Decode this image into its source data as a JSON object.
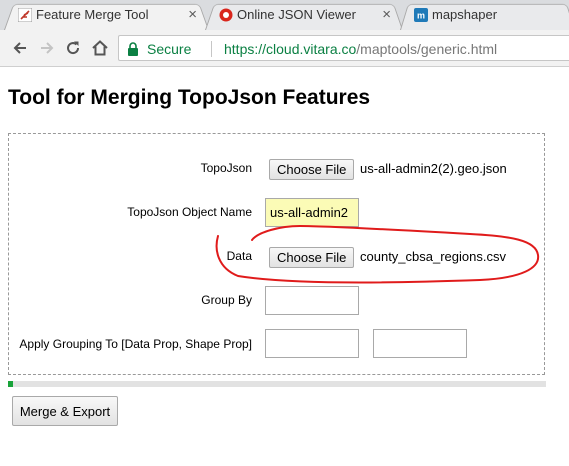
{
  "browser": {
    "tabs": [
      {
        "title": "Feature Merge Tool",
        "icon": "feather-icon",
        "active": true
      },
      {
        "title": "Online JSON Viewer",
        "icon": "json-viewer-icon",
        "active": false
      },
      {
        "title": "mapshaper",
        "icon": "mapshaper-icon",
        "active": false
      }
    ],
    "close_glyph": "×",
    "secure_label": "Secure",
    "url_host": "https://cloud.vitara.co",
    "url_path": "/maptools/generic.html"
  },
  "page": {
    "title": "Tool for Merging TopoJson Features",
    "form": {
      "topojson_label": "TopoJson",
      "topojson_button": "Choose File",
      "topojson_file": "us-all-admin2(2).geo.json",
      "object_name_label": "TopoJson Object Name",
      "object_name_value": "us-all-admin2",
      "data_label": "Data",
      "data_button": "Choose File",
      "data_file": "county_cbsa_regions.csv",
      "group_by_label": "Group By",
      "group_by_value": "",
      "apply_grouping_label": "Apply Grouping To [Data Prop, Shape Prop]",
      "data_prop_value": "",
      "shape_prop_value": ""
    },
    "progress_fraction": 0.01,
    "merge_button": "Merge & Export"
  },
  "colors": {
    "secure_green": "#0b8043",
    "progress_green": "#19a33a",
    "annotation_red": "#e01b1b",
    "autofill_yellow": "#fbfbb6"
  }
}
